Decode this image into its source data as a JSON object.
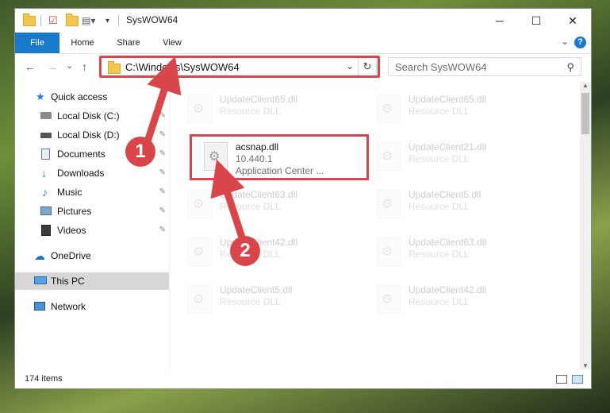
{
  "window": {
    "title": "SysWOW64",
    "minimize_glyph": "─",
    "maximize_glyph": "☐",
    "close_glyph": "✕"
  },
  "ribbon": {
    "tabs": [
      "File",
      "Home",
      "Share",
      "View"
    ],
    "help": "?",
    "expand_glyph": "⌄"
  },
  "nav": {
    "back": "←",
    "forward": "→",
    "recent": "⌄",
    "up": "↑"
  },
  "address": {
    "path": "C:\\Windows\\SysWOW64",
    "dropdown": "⌄",
    "refresh": "↻"
  },
  "search": {
    "placeholder": "Search SysWOW64",
    "icon": "⚲"
  },
  "sidebar": {
    "items": [
      {
        "label": "Quick access",
        "icon": "star-icon"
      },
      {
        "label": "Local Disk (C:)",
        "icon": "drive-icon",
        "pinned": true
      },
      {
        "label": "Local Disk (D:)",
        "icon": "drive-icon",
        "pinned": true
      },
      {
        "label": "Documents",
        "icon": "documents-icon",
        "pinned": true
      },
      {
        "label": "Downloads",
        "icon": "downloads-icon",
        "pinned": true
      },
      {
        "label": "Music",
        "icon": "music-icon",
        "pinned": true
      },
      {
        "label": "Pictures",
        "icon": "pictures-icon",
        "pinned": true
      },
      {
        "label": "Videos",
        "icon": "videos-icon",
        "pinned": true
      },
      {
        "label": "OneDrive",
        "icon": "cloud-icon"
      },
      {
        "label": "This PC",
        "icon": "computer-icon",
        "selected": true
      },
      {
        "label": "Network",
        "icon": "network-icon"
      }
    ],
    "pin_glyph": "📌"
  },
  "files": {
    "highlighted": {
      "name": "acsnap.dll",
      "version": "10.440.1",
      "description": "Application Center ..."
    },
    "background": [
      {
        "name": "UpdateClient65.dll",
        "type": "Resource DLL"
      },
      {
        "name": "UpdateClient65.dll",
        "type": "Resource DLL"
      },
      {
        "name": "UpdateClient21.dll",
        "type": "Resource DLL"
      },
      {
        "name": "UpdateClient63.dll",
        "type": "Resource DLL"
      },
      {
        "name": "UpdateClient5.dll",
        "type": "Resource DLL"
      },
      {
        "name": "UpdateClient42.dll",
        "type": "Resource DLL"
      },
      {
        "name": "UpdateClient63.dll",
        "type": "Resource DLL"
      },
      {
        "name": "UpdateClient5.dll",
        "type": "Resource DLL"
      },
      {
        "name": "UpdateClient42.dll",
        "type": "Resource DLL"
      }
    ]
  },
  "status": {
    "item_count": "174 items"
  },
  "annotations": {
    "step1": "1",
    "step2": "2",
    "color": "#d9464a"
  }
}
